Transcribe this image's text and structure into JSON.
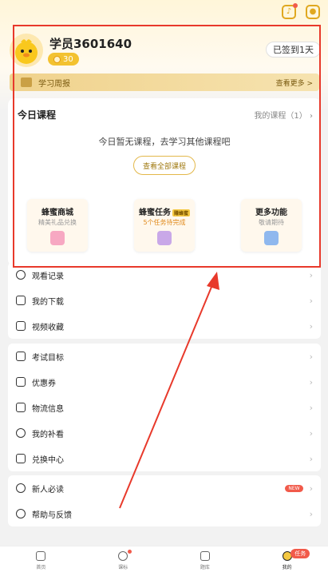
{
  "header": {
    "notification_icon": "bell-icon",
    "settings_icon": "hexagon-settings-icon"
  },
  "profile": {
    "username": "学员3601640",
    "coins": "30",
    "checkin_label": "已签到1天"
  },
  "weekly_report": {
    "label": "学习周报",
    "more_label": "查看更多 >"
  },
  "today_course": {
    "title": "今日课程",
    "my_courses": "我的课程（1）",
    "empty_text": "今日暂无课程，去学习其他课程吧",
    "view_all_label": "查看全部课程"
  },
  "features": [
    {
      "title": "蜂蜜商城",
      "subtitle": "精美礼品兑换",
      "icon": "shopping-bag-icon",
      "color": "#f7a8c2"
    },
    {
      "title": "蜂蜜任务",
      "tag": "赚蜂蜜",
      "subtitle": "5个任务待完成",
      "icon": "task-flag-icon",
      "color": "#c9a8e8"
    },
    {
      "title": "更多功能",
      "subtitle": "敬请期待",
      "icon": "grid-blocks-icon",
      "color": "#8fb8ee"
    }
  ],
  "menu_groups": [
    [
      {
        "label": "观看记录",
        "icon": "clock-icon"
      },
      {
        "label": "我的下载",
        "icon": "download-icon"
      },
      {
        "label": "视频收藏",
        "icon": "video-favorite-icon"
      }
    ],
    [
      {
        "label": "考试目标",
        "icon": "target-grid-icon"
      },
      {
        "label": "优惠券",
        "icon": "coupon-icon"
      },
      {
        "label": "物流信息",
        "icon": "truck-icon"
      },
      {
        "label": "我的补看",
        "icon": "replay-icon"
      },
      {
        "label": "兑换中心",
        "icon": "exchange-icon"
      }
    ],
    [
      {
        "label": "新人必读",
        "icon": "compass-icon",
        "badge": "NEW"
      },
      {
        "label": "帮助与反馈",
        "icon": "help-icon"
      }
    ]
  ],
  "tabbar": [
    {
      "label": "首页",
      "icon": "home-book-icon"
    },
    {
      "label": "课标",
      "icon": "play-clock-icon"
    },
    {
      "label": "题库",
      "icon": "question-bank-icon"
    },
    {
      "label": "我的",
      "icon": "bee-icon",
      "badge": "任务"
    }
  ],
  "colors": {
    "accent": "#f3c230",
    "highlight_border": "#e8392b",
    "annotation_arrow": "#e8392b"
  }
}
